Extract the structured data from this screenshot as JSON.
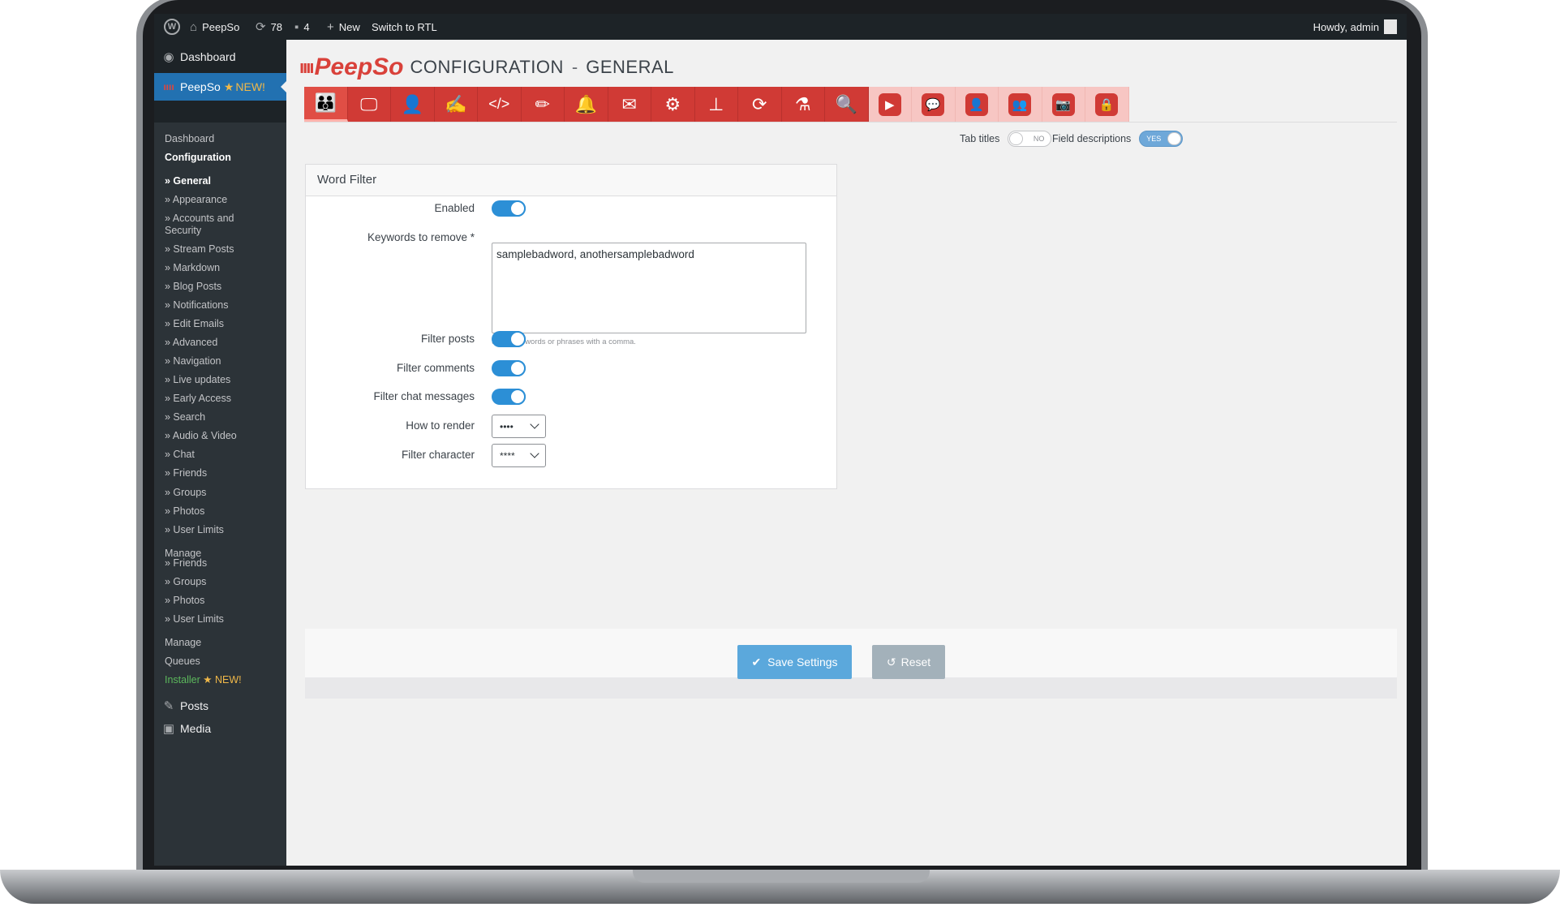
{
  "adminbar": {
    "site_name": "PeepSo",
    "updates_count": "78",
    "comments_count": "4",
    "new_label": "New",
    "rtl_label": "Switch to RTL",
    "howdy": "Howdy, admin"
  },
  "sidebar": {
    "dashboard": "Dashboard",
    "peepso": "PeepSo",
    "new_badge": "NEW!",
    "submenu": [
      "Dashboard",
      "Configuration",
      "» General",
      "» Appearance",
      "» Accounts and",
      "Security",
      "» Stream Posts",
      "» Markdown",
      "» Blog Posts",
      "» Notifications",
      "» Edit Emails",
      "» Advanced",
      "» Navigation",
      "» Live updates",
      "» Early Access",
      "» Search",
      "» Audio & Video",
      "» Chat",
      "» Friends",
      "» Groups",
      "» Photos",
      "» User Limits",
      "Manage",
      "» Friends",
      "» Groups",
      "» Photos",
      "» User Limits",
      "Manage",
      "Queues",
      "Installer",
      "NEW!"
    ],
    "posts": "Posts",
    "media": "Media"
  },
  "header": {
    "logo": "PeepSo",
    "configuration": "CONFIGURATION",
    "separator": "-",
    "section": "GENERAL"
  },
  "tabs": [
    {
      "icon": "community-icon"
    },
    {
      "icon": "appearance-icon"
    },
    {
      "icon": "account-security-icon"
    },
    {
      "icon": "stream-posts-icon"
    },
    {
      "icon": "markdown-code-icon"
    },
    {
      "icon": "blog-pencil-icon"
    },
    {
      "icon": "notifications-bell-icon"
    },
    {
      "icon": "edit-emails-icon"
    },
    {
      "icon": "advanced-gears-icon"
    },
    {
      "icon": "navigation-sitemap-icon"
    },
    {
      "icon": "live-updates-icon"
    },
    {
      "icon": "early-access-flask-icon"
    },
    {
      "icon": "search-icon"
    },
    {
      "icon": "audio-video-icon"
    },
    {
      "icon": "chat-icon"
    },
    {
      "icon": "friends-icon"
    },
    {
      "icon": "groups-icon"
    },
    {
      "icon": "photos-icon"
    },
    {
      "icon": "user-limits-lock-icon"
    }
  ],
  "options": {
    "tab_titles_label": "Tab titles",
    "tab_titles_value": "NO",
    "field_desc_label": "Field descriptions",
    "field_desc_value": "YES"
  },
  "panel": {
    "title": "Word Filter",
    "enabled_label": "Enabled",
    "enabled": true,
    "keywords_label": "Keywords to remove *",
    "keywords_value": "samplebadword, anothersamplebadword",
    "keywords_hint": "Separate words or phrases with a comma.",
    "filter_posts_label": "Filter posts",
    "filter_posts": true,
    "filter_comments_label": "Filter comments",
    "filter_comments": true,
    "filter_chat_label": "Filter chat messages",
    "filter_chat": true,
    "render_label": "How to render",
    "render_value": "••••",
    "char_label": "Filter character",
    "char_value": "****"
  },
  "footer": {
    "save_label": "Save Settings",
    "reset_label": "Reset"
  },
  "colors": {
    "peepso_red": "#d03a35",
    "wp_blue": "#2271b1",
    "toggle_blue": "#2c8fd6",
    "save_blue": "#5ba8dc"
  }
}
